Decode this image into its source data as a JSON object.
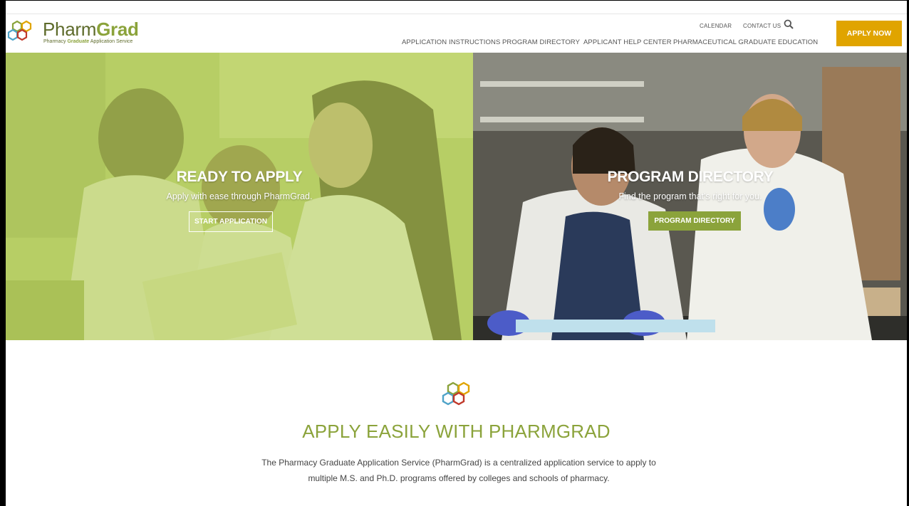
{
  "brand": {
    "name_part1": "Pharm",
    "name_part2": "Grad",
    "tagline_part1": "Pharmacy ",
    "tagline_part2": "Graduate",
    "tagline_part3": " Application Service",
    "colors": {
      "green": "#8ba33b",
      "dark_green": "#5e6b2b",
      "gold": "#e0a400",
      "red": "#c0392b",
      "blue": "#4fa3c8"
    }
  },
  "utility_nav": {
    "calendar": "CALENDAR",
    "contact": "CONTACT US",
    "search_icon": "search-icon"
  },
  "main_nav": [
    "APPLICATION INSTRUCTIONS",
    "PROGRAM DIRECTORY",
    "APPLICANT HELP CENTER",
    "PHARMACEUTICAL GRADUATE EDUCATION"
  ],
  "apply_now": "APPLY NOW",
  "hero": {
    "left": {
      "title": "READY TO APPLY",
      "subtitle": "Apply with ease through PharmGrad.",
      "button": "START APPLICATION"
    },
    "right": {
      "title": "PROGRAM DIRECTORY",
      "subtitle": "Find the program that's right for you.",
      "button": "PROGRAM DIRECTORY"
    }
  },
  "intro": {
    "title": "APPLY EASILY WITH PHARMGRAD",
    "body_line1": "The Pharmacy Graduate Application Service (PharmGrad) is a centralized application service to apply to",
    "body_line2": "multiple M.S. and Ph.D. programs offered by colleges and schools of pharmacy."
  }
}
